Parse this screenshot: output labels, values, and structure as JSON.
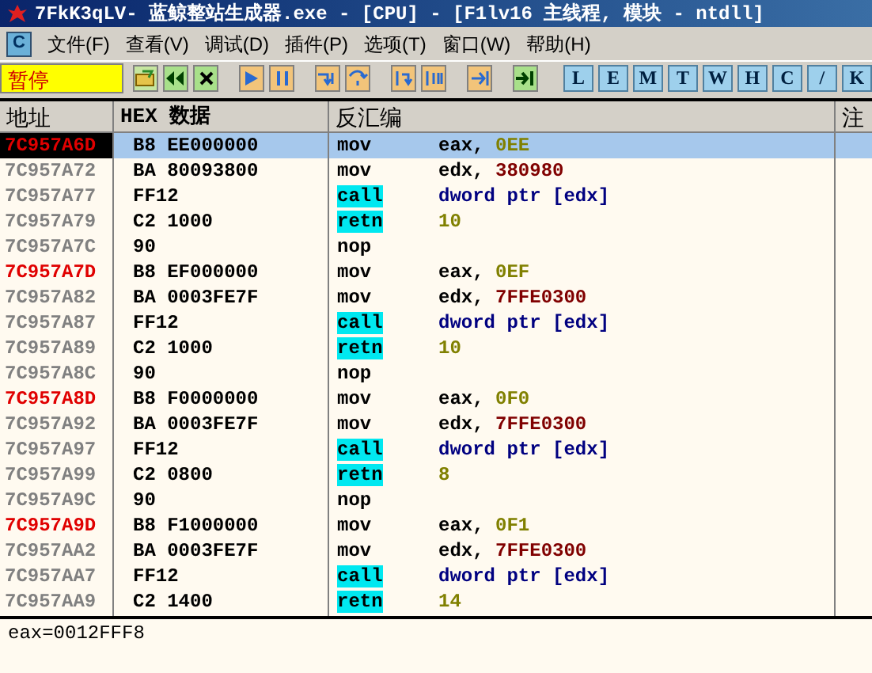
{
  "window": {
    "title": "7FkK3qLV- 蓝鲸整站生成器.exe - [CPU] - [F1lv16 主线程, 模块 - ntdll]"
  },
  "menu": {
    "app_icon": "C",
    "items": [
      "文件(F)",
      "查看(V)",
      "调试(D)",
      "插件(P)",
      "选项(T)",
      "窗口(W)",
      "帮助(H)"
    ]
  },
  "toolbar": {
    "status": "暂停",
    "tools": [
      {
        "kind": "open"
      },
      {
        "kind": "rewind"
      },
      {
        "kind": "close"
      },
      {
        "kind": "gap"
      },
      {
        "kind": "run"
      },
      {
        "kind": "pause"
      },
      {
        "kind": "gap"
      },
      {
        "kind": "step-into"
      },
      {
        "kind": "step-over"
      },
      {
        "kind": "gap"
      },
      {
        "kind": "trace-into"
      },
      {
        "kind": "trace-over"
      },
      {
        "kind": "gap"
      },
      {
        "kind": "till-return"
      },
      {
        "kind": "gap"
      },
      {
        "kind": "go-to"
      }
    ],
    "letters": [
      "L",
      "E",
      "M",
      "T",
      "W",
      "H",
      "C",
      "/",
      "K"
    ]
  },
  "table": {
    "columns": [
      "地址",
      "HEX 数据",
      "反汇编",
      "注"
    ],
    "rows": [
      {
        "address": "7C957A6D",
        "hex": "B8 EE000000",
        "mnemonic": "mov",
        "control": false,
        "label": true,
        "selected": true,
        "operands": [
          {
            "text": "eax, ",
            "kind": "register"
          },
          {
            "text": "0EE",
            "kind": "const"
          }
        ]
      },
      {
        "address": "7C957A72",
        "hex": "BA 80093800",
        "mnemonic": "mov",
        "control": false,
        "label": false,
        "selected": false,
        "operands": [
          {
            "text": "edx, ",
            "kind": "register"
          },
          {
            "text": "380980",
            "kind": "address"
          }
        ]
      },
      {
        "address": "7C957A77",
        "hex": "FF12",
        "mnemonic": "call",
        "control": true,
        "label": false,
        "selected": false,
        "operands": [
          {
            "text": "dword ptr [edx]",
            "kind": "memory"
          }
        ]
      },
      {
        "address": "7C957A79",
        "hex": "C2 1000",
        "mnemonic": "retn",
        "control": true,
        "label": false,
        "selected": false,
        "operands": [
          {
            "text": "10",
            "kind": "const"
          }
        ]
      },
      {
        "address": "7C957A7C",
        "hex": "90",
        "mnemonic": "nop",
        "control": false,
        "label": false,
        "selected": false,
        "operands": []
      },
      {
        "address": "7C957A7D",
        "hex": "B8 EF000000",
        "mnemonic": "mov",
        "control": false,
        "label": true,
        "selected": false,
        "operands": [
          {
            "text": "eax, ",
            "kind": "register"
          },
          {
            "text": "0EF",
            "kind": "const"
          }
        ]
      },
      {
        "address": "7C957A82",
        "hex": "BA 0003FE7F",
        "mnemonic": "mov",
        "control": false,
        "label": false,
        "selected": false,
        "operands": [
          {
            "text": "edx, ",
            "kind": "register"
          },
          {
            "text": "7FFE0300",
            "kind": "address"
          }
        ]
      },
      {
        "address": "7C957A87",
        "hex": "FF12",
        "mnemonic": "call",
        "control": true,
        "label": false,
        "selected": false,
        "operands": [
          {
            "text": "dword ptr [edx]",
            "kind": "memory"
          }
        ]
      },
      {
        "address": "7C957A89",
        "hex": "C2 1000",
        "mnemonic": "retn",
        "control": true,
        "label": false,
        "selected": false,
        "operands": [
          {
            "text": "10",
            "kind": "const"
          }
        ]
      },
      {
        "address": "7C957A8C",
        "hex": "90",
        "mnemonic": "nop",
        "control": false,
        "label": false,
        "selected": false,
        "operands": []
      },
      {
        "address": "7C957A8D",
        "hex": "B8 F0000000",
        "mnemonic": "mov",
        "control": false,
        "label": true,
        "selected": false,
        "operands": [
          {
            "text": "eax, ",
            "kind": "register"
          },
          {
            "text": "0F0",
            "kind": "const"
          }
        ]
      },
      {
        "address": "7C957A92",
        "hex": "BA 0003FE7F",
        "mnemonic": "mov",
        "control": false,
        "label": false,
        "selected": false,
        "operands": [
          {
            "text": "edx, ",
            "kind": "register"
          },
          {
            "text": "7FFE0300",
            "kind": "address"
          }
        ]
      },
      {
        "address": "7C957A97",
        "hex": "FF12",
        "mnemonic": "call",
        "control": true,
        "label": false,
        "selected": false,
        "operands": [
          {
            "text": "dword ptr [edx]",
            "kind": "memory"
          }
        ]
      },
      {
        "address": "7C957A99",
        "hex": "C2 0800",
        "mnemonic": "retn",
        "control": true,
        "label": false,
        "selected": false,
        "operands": [
          {
            "text": "8",
            "kind": "const"
          }
        ]
      },
      {
        "address": "7C957A9C",
        "hex": "90",
        "mnemonic": "nop",
        "control": false,
        "label": false,
        "selected": false,
        "operands": []
      },
      {
        "address": "7C957A9D",
        "hex": "B8 F1000000",
        "mnemonic": "mov",
        "control": false,
        "label": true,
        "selected": false,
        "operands": [
          {
            "text": "eax, ",
            "kind": "register"
          },
          {
            "text": "0F1",
            "kind": "const"
          }
        ]
      },
      {
        "address": "7C957AA2",
        "hex": "BA 0003FE7F",
        "mnemonic": "mov",
        "control": false,
        "label": false,
        "selected": false,
        "operands": [
          {
            "text": "edx, ",
            "kind": "register"
          },
          {
            "text": "7FFE0300",
            "kind": "address"
          }
        ]
      },
      {
        "address": "7C957AA7",
        "hex": "FF12",
        "mnemonic": "call",
        "control": true,
        "label": false,
        "selected": false,
        "operands": [
          {
            "text": "dword ptr [edx]",
            "kind": "memory"
          }
        ]
      },
      {
        "address": "7C957AA9",
        "hex": "C2 1400",
        "mnemonic": "retn",
        "control": true,
        "label": false,
        "selected": false,
        "operands": [
          {
            "text": "14",
            "kind": "const"
          }
        ]
      }
    ]
  },
  "info_pane": {
    "text": "eax=0012FFF8"
  }
}
